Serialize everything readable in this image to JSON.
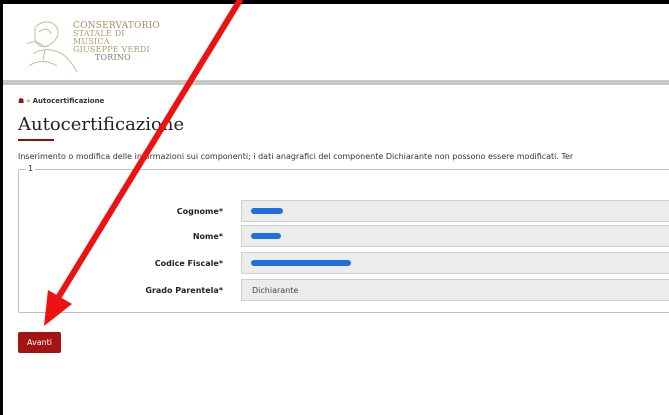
{
  "header": {
    "logo_lines": [
      "CONSERVATORIO",
      "STATALE DI MUSICA",
      "GIUSEPPE VERDI",
      "TORINO"
    ]
  },
  "breadcrumb": {
    "current": "Autocertificazione",
    "separator": "»"
  },
  "page": {
    "title": "Autocertificazione",
    "description": "Inserimento o modifica delle informazioni sui componenti; i dati anagrafici del componente Dichiarante non possono essere modificati. Ter"
  },
  "form": {
    "legend": "1",
    "fields": [
      {
        "label": "Cognome*",
        "value": ""
      },
      {
        "label": "Nome*",
        "value": ""
      },
      {
        "label": "Codice Fiscale*",
        "value": ""
      },
      {
        "label": "Grado Parentela*",
        "value": "Dichiarante"
      }
    ]
  },
  "actions": {
    "next_label": "Avanti"
  },
  "colors": {
    "accent": "#a51414",
    "annotation_arrow": "#ee1111",
    "redaction": "#1f6fe0"
  }
}
